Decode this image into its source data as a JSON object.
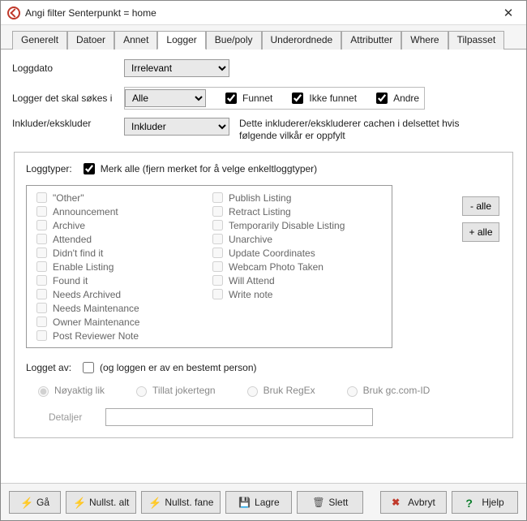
{
  "window": {
    "title": "Angi filter      Senterpunkt = home"
  },
  "tabs": [
    {
      "label": "Generelt"
    },
    {
      "label": "Datoer"
    },
    {
      "label": "Annet"
    },
    {
      "label": "Logger",
      "active": true
    },
    {
      "label": "Bue/poly"
    },
    {
      "label": "Underordnede"
    },
    {
      "label": "Attributter"
    },
    {
      "label": "Where"
    },
    {
      "label": "Tilpasset"
    }
  ],
  "fields": {
    "logdate_label": "Loggdato",
    "logdate_value": "Irrelevant",
    "search_label": "Logger det skal søkes i",
    "search_value": "Alle",
    "funnet": "Funnet",
    "ikke_funnet": "Ikke funnet",
    "andre": "Andre",
    "include_label": "Inkluder/ekskluder",
    "include_value": "Inkluder",
    "include_note": "Dette inkluderer/ekskluderer cachen i delsettet hvis følgende vilkår er oppfylt",
    "logtypes_label": "Loggtyper:",
    "mark_all_label": "Merk alle (fjern merket for å velge enkeltloggtyper)",
    "minus_all": "- alle",
    "plus_all": "+ alle",
    "logged_by_label": "Logget av:",
    "logged_by_chk_label": "(og loggen er av en bestemt person)",
    "radios": {
      "exact": "Nøyaktig lik",
      "wild": "Tillat jokertegn",
      "regex": "Bruk RegEx",
      "gcid": "Bruk gc.com-ID"
    },
    "details_label": "Detaljer",
    "details_value": ""
  },
  "logtypes_left": [
    "\"Other\"",
    "Announcement",
    "Archive",
    "Attended",
    "Didn't find it",
    "Enable Listing",
    "Found it",
    "Needs Archived",
    "Needs Maintenance",
    "Owner Maintenance",
    "Post Reviewer Note"
  ],
  "logtypes_right": [
    "Publish Listing",
    "Retract Listing",
    "Temporarily Disable Listing",
    "Unarchive",
    "Update Coordinates",
    "Webcam Photo Taken",
    "Will Attend",
    "Write note"
  ],
  "footer": {
    "go": "Gå",
    "reset_all": "Nullst. alt",
    "reset_tab": "Nullst. fane",
    "save": "Lagre",
    "delete": "Slett",
    "cancel": "Avbryt",
    "help": "Hjelp"
  }
}
